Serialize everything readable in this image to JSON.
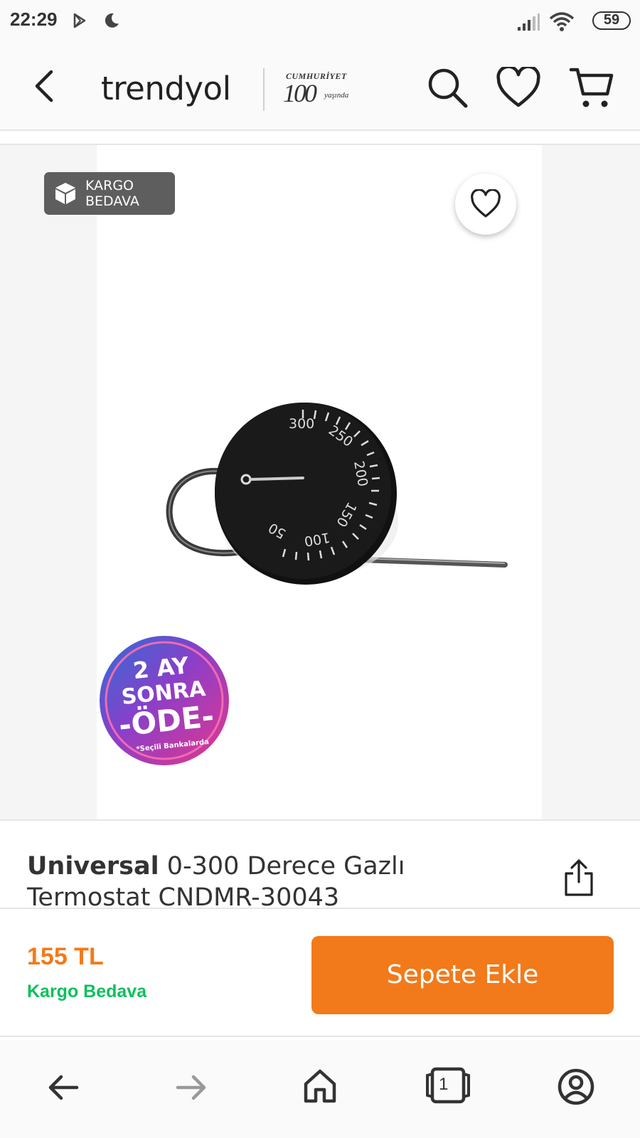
{
  "status_bar": {
    "time": "22:29",
    "battery": "59",
    "icons": [
      "play-store-icon",
      "moon-icon",
      "signal-icon",
      "wifi-icon",
      "battery-icon"
    ]
  },
  "header": {
    "logo": "trendyol",
    "campaign_logo": {
      "top": "CUMHURİYET",
      "number": "100",
      "sub": "yaşında"
    },
    "icons": [
      "back-arrow-icon",
      "search-icon",
      "heart-icon",
      "cart-icon"
    ]
  },
  "gallery": {
    "badge_line1": "KARGO",
    "badge_line2": "BEDAVA",
    "dial_labels": [
      "300",
      "250",
      "200",
      "150",
      "100",
      "50"
    ],
    "promo": {
      "line1": "2 AY",
      "line2": "SONRA",
      "line3": "-ÖDE-",
      "line4": "*Seçili Bankalarda"
    }
  },
  "product": {
    "brand": "Universal",
    "name": " 0-300 Derece Gazlı Termostat CNDMR-30043"
  },
  "purchase": {
    "price": "155 TL",
    "shipping": "Kargo Bedava",
    "add_to_cart": "Sepete Ekle"
  },
  "browser_nav": {
    "tab_count": "1",
    "icons": [
      "back-icon",
      "forward-icon",
      "home-icon",
      "tabs-icon",
      "profile-icon"
    ]
  },
  "colors": {
    "accent": "#f27a1a",
    "shipping_green": "#0bc15c",
    "badge_gray": "#5e5e5e"
  }
}
